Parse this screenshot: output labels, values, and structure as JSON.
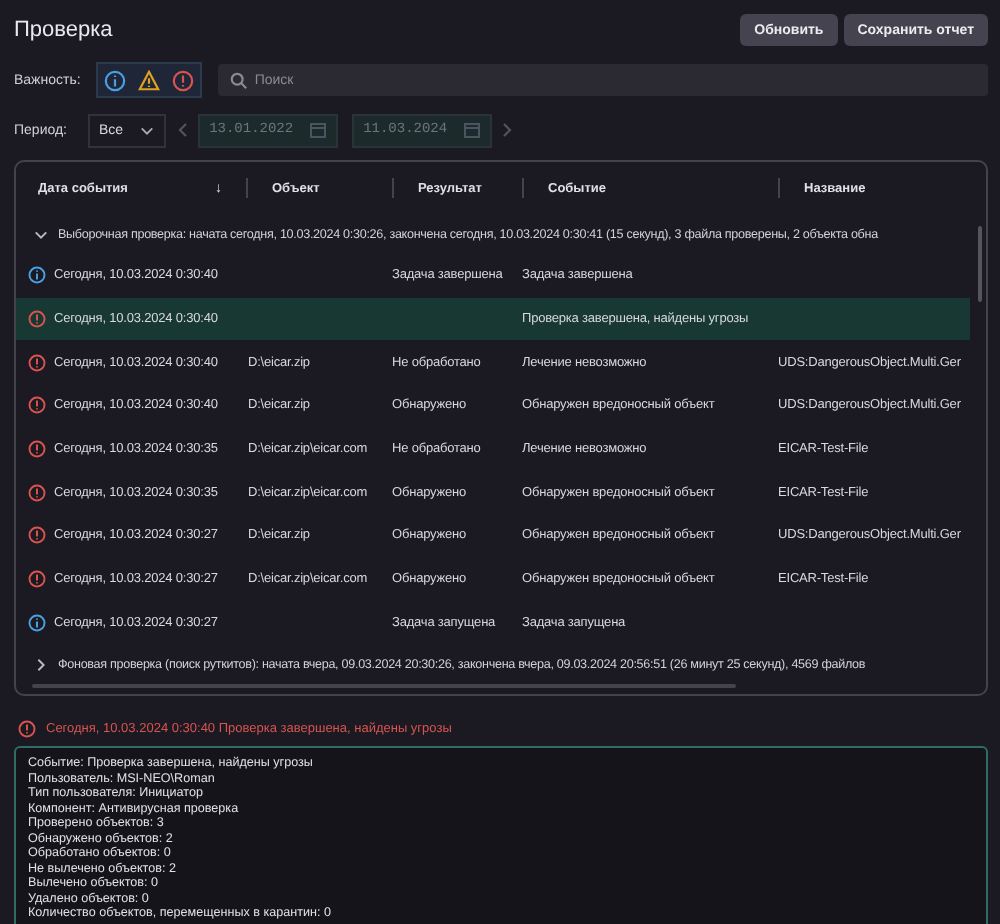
{
  "title": "Проверка",
  "buttons": [
    "Обновить",
    "Сохранить отчет"
  ],
  "severity": {
    "label": "Важность:",
    "filters": [
      {
        "kind": "info"
      },
      {
        "kind": "warning"
      },
      {
        "kind": "error"
      }
    ]
  },
  "search": {
    "placeholder": "Поиск"
  },
  "period": {
    "label": "Период:",
    "value": "Все",
    "from": "13.01.2022",
    "to": "11.03.2024"
  },
  "table": {
    "columns": [
      {
        "label": "Дата события",
        "sort": "↓"
      },
      {
        "label": "Объект"
      },
      {
        "label": "Результат"
      },
      {
        "label": "Событие"
      },
      {
        "label": "Название"
      }
    ],
    "groups": [
      {
        "title": "Выборочная проверка: начата сегодня, 10.03.2024 0:30:26, закончена сегодня, 10.03.2024 0:30:41 (15 секунд), 3 файла проверены, 2 объекта обна",
        "expanded": true,
        "rows": [
          {
            "kind": "info",
            "selected": false,
            "date": "Сегодня, 10.03.2024 0:30:40",
            "object": "",
            "result": "Задача завершена",
            "event": "Задача завершена",
            "name": ""
          },
          {
            "kind": "error",
            "selected": true,
            "date": "Сегодня, 10.03.2024 0:30:40",
            "object": "",
            "result": "",
            "event": "Проверка завершена, найдены угрозы",
            "name": ""
          },
          {
            "kind": "error",
            "selected": false,
            "date": "Сегодня, 10.03.2024 0:30:40",
            "object": "D:\\eicar.zip",
            "result": "Не обработано",
            "event": "Лечение невозможно",
            "name": "UDS:DangerousObject.Multi.Ger"
          },
          {
            "kind": "error",
            "selected": false,
            "date": "Сегодня, 10.03.2024 0:30:40",
            "object": "D:\\eicar.zip",
            "result": "Обнаружено",
            "event": "Обнаружен вредоносный объект",
            "name": "UDS:DangerousObject.Multi.Ger"
          },
          {
            "kind": "error",
            "selected": false,
            "date": "Сегодня, 10.03.2024 0:30:35",
            "object": "D:\\eicar.zip\\eicar.com",
            "result": "Не обработано",
            "event": "Лечение невозможно",
            "name": "EICAR-Test-File"
          },
          {
            "kind": "error",
            "selected": false,
            "date": "Сегодня, 10.03.2024 0:30:35",
            "object": "D:\\eicar.zip\\eicar.com",
            "result": "Обнаружено",
            "event": "Обнаружен вредоносный объект",
            "name": "EICAR-Test-File"
          },
          {
            "kind": "error",
            "selected": false,
            "date": "Сегодня, 10.03.2024 0:30:27",
            "object": "D:\\eicar.zip",
            "result": "Обнаружено",
            "event": "Обнаружен вредоносный объект",
            "name": "UDS:DangerousObject.Multi.Ger"
          },
          {
            "kind": "error",
            "selected": false,
            "date": "Сегодня, 10.03.2024 0:30:27",
            "object": "D:\\eicar.zip\\eicar.com",
            "result": "Обнаружено",
            "event": "Обнаружен вредоносный объект",
            "name": "EICAR-Test-File"
          },
          {
            "kind": "info",
            "selected": false,
            "date": "Сегодня, 10.03.2024 0:30:27",
            "object": "",
            "result": "Задача запущена",
            "event": "Задача запущена",
            "name": ""
          }
        ]
      },
      {
        "title": "Фоновая проверка (поиск руткитов): начата вчера, 09.03.2024 20:30:26, закончена вчера, 09.03.2024 20:56:51 (26 минут 25 секунд), 4569 файлов",
        "expanded": false
      }
    ]
  },
  "message": {
    "kind": "error",
    "text": "Сегодня, 10.03.2024 0:30:40 Проверка завершена, найдены угрозы"
  },
  "details": [
    "Событие: Проверка завершена, найдены угрозы",
    "Пользователь: MSI-NEO\\Roman",
    "Тип пользователя: Инициатор",
    "Компонент: Антивирусная проверка",
    "Проверено объектов: 3",
    "Обнаружено объектов: 2",
    "Обработано объектов: 0",
    "Не вылечено объектов: 2",
    "Вылечено объектов: 0",
    "Удалено объектов: 0",
    "Количество объектов, перемещенных в карантин: 0"
  ]
}
